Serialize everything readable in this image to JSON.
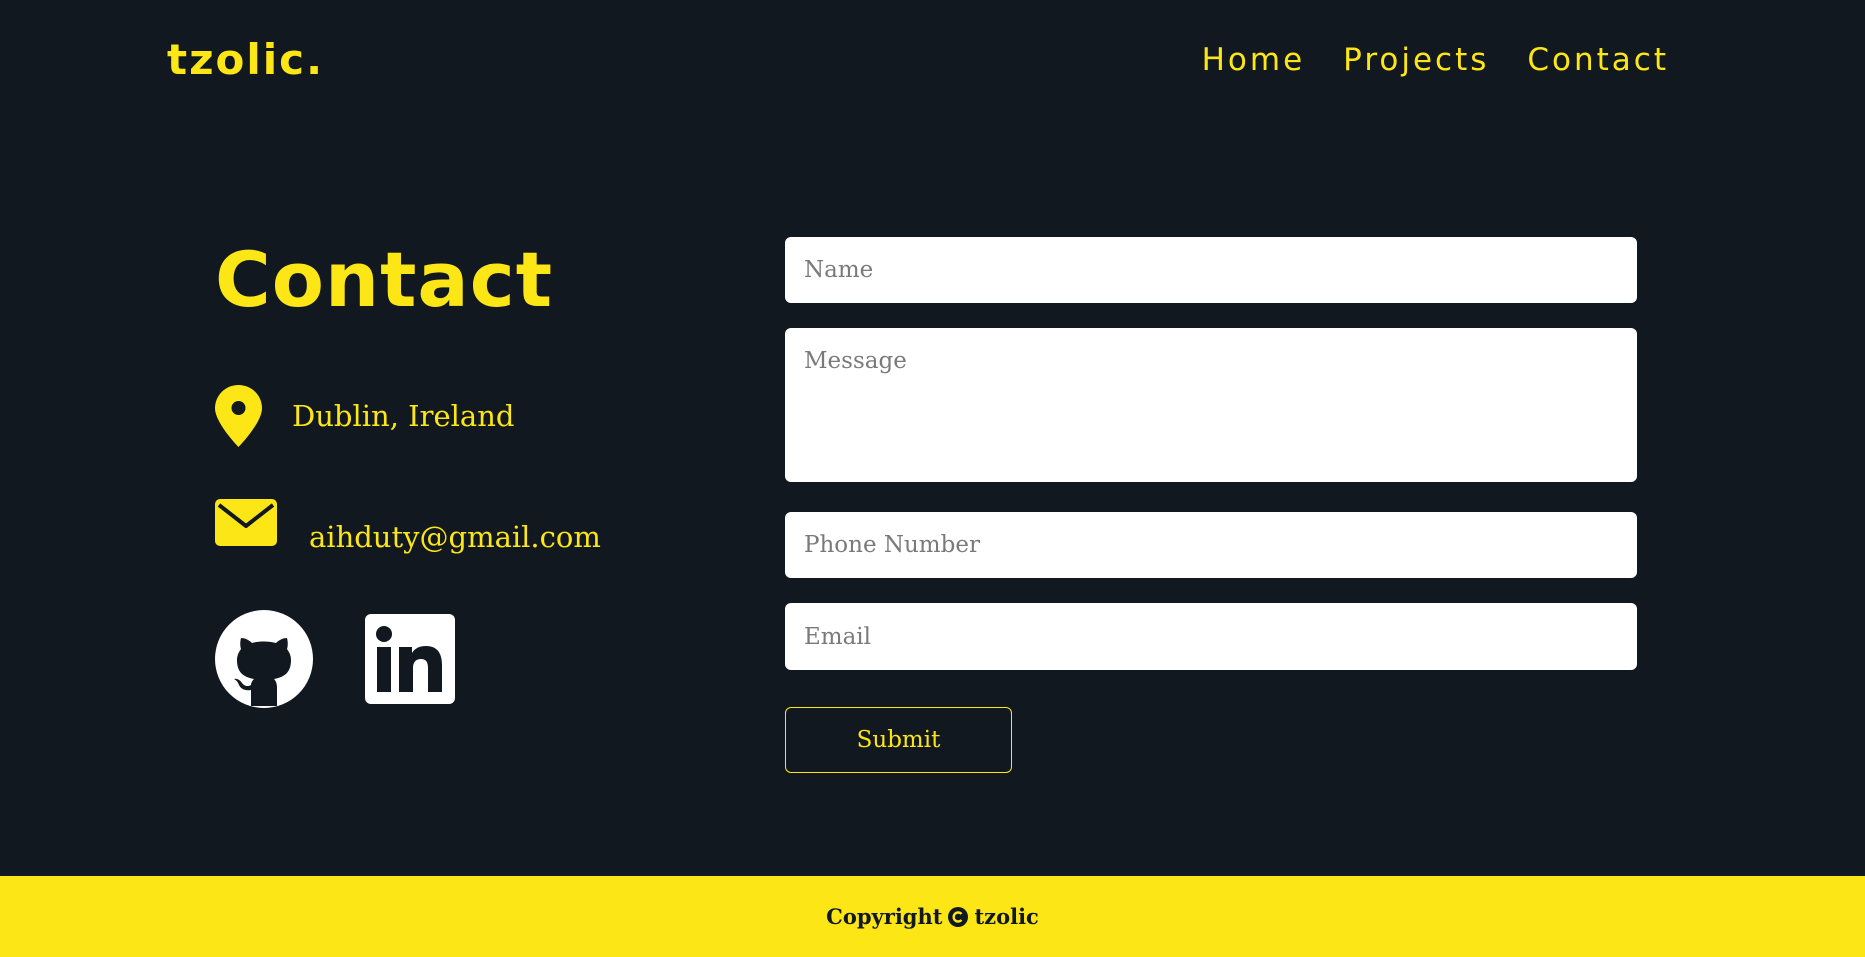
{
  "header": {
    "logo": "tzolic.",
    "nav": [
      "Home",
      "Projects",
      "Contact"
    ]
  },
  "contact": {
    "title": "Contact",
    "location": "Dublin, Ireland",
    "email": "aihduty@gmail.com",
    "social": [
      "github-icon",
      "linkedin-icon"
    ]
  },
  "form": {
    "name_placeholder": "Name",
    "message_placeholder": "Message",
    "phone_placeholder": "Phone Number",
    "email_placeholder": "Email",
    "submit_label": "Submit"
  },
  "footer": {
    "copyright_label": "Copyright",
    "copyright_owner": "tzolic"
  },
  "colors": {
    "background": "#111820",
    "accent": "#fde616",
    "input_bg": "#ffffff"
  }
}
